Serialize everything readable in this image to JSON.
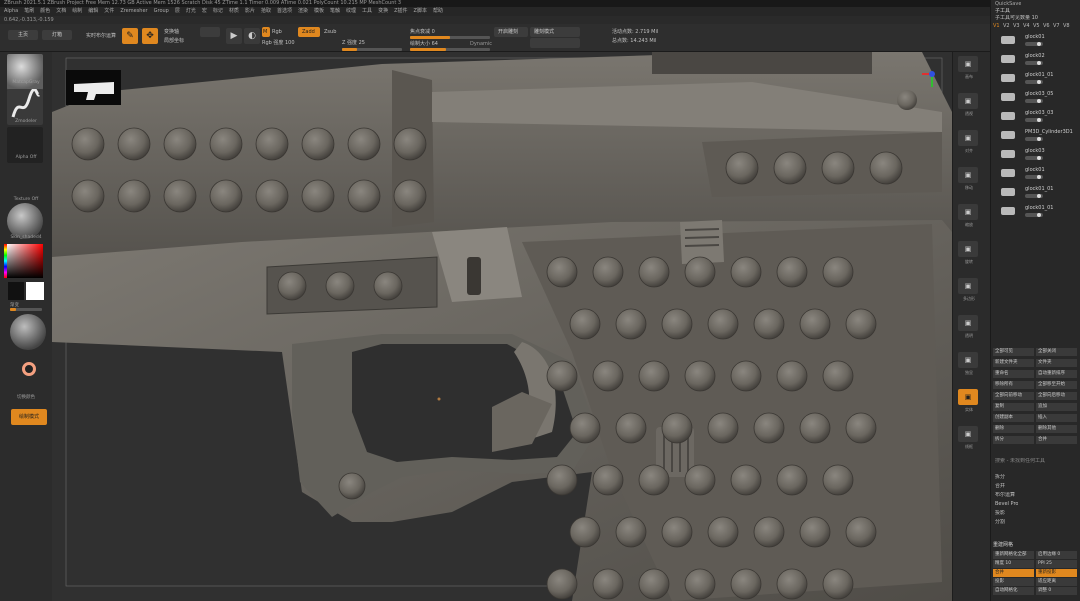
{
  "title_bar": "ZBrush 2021.5.1   ZBrush Project   Free Mem 12.73 GB   Active Mem 1526   Scratch Disk 45   ZTime 1.1   Timer 0.009   ATime 0.021   PolyCount 10.215 MP   MeshCount 3",
  "title_right": {
    "quicksave": "QuickSave",
    "seethrough": "透明度 0",
    "menus": "菜单",
    "script": "DefaultZScript"
  },
  "menu_items": [
    "Alpha",
    "笔刷",
    "颜色",
    "文档",
    "绘制",
    "编辑",
    "文件",
    "Zremesher",
    "Group",
    "层",
    "灯光",
    "宏",
    "标记",
    "材质",
    "影片",
    "拾取",
    "首选项",
    "渲染",
    "模板",
    "笔触",
    "纹理",
    "工具",
    "变换",
    "Z插件",
    "Z脚本",
    "帮助"
  ],
  "coords": "0.642,-0.313,-0.159",
  "toolbar": {
    "home": "主页",
    "lightbox": "灯箱",
    "live_boolean": "实时布尔运算",
    "edit_icon": "✎",
    "draw_icon": "✥",
    "transform_axis": "变换轴",
    "local_coords": "局部坐标",
    "mrgb": "Mrgb",
    "rgb": "Rgb",
    "rgb_intensity": "Rgb 强度 100",
    "m": "M",
    "zadd": "Zadd",
    "zsub": "Zsub",
    "z_intensity": "Z 强度 25",
    "focal_shift": "焦点衰减 0",
    "draw_size": "绘制大小 64",
    "dynamic": "Dynamic",
    "active_points": "活动点数: 2.719 Mil",
    "total_points": "总点数: 14.243 Mil",
    "sculpt_toggle": "开启雕刻",
    "sculpt_mode": "雕刻模式"
  },
  "left_panel": {
    "brush1": "MatcapGray",
    "brush2": "Zmodeler",
    "alpha": "Alpha Off",
    "texture": "Texture Off",
    "material": "Skin_shaded4",
    "gradient_label": "渐变",
    "switch_color": "切换颜色",
    "edit_mode": "绘制模式"
  },
  "right_strip": [
    "画布",
    "透视",
    "对齐",
    "移动",
    "缩放",
    "旋转",
    "多边形",
    "透明",
    "独显",
    "实体",
    "线框"
  ],
  "right_panel": {
    "header": "子工具",
    "list_count": "子工具可见数量  10",
    "vtabs": [
      "V1",
      "V2",
      "V3",
      "V4",
      "V5",
      "V6",
      "V7",
      "V8"
    ],
    "items": [
      "glock01",
      "glock02",
      "glock01_01",
      "glock03_05",
      "glock03_03",
      "PM3D_Cylinder3D1",
      "glock03",
      "glock01",
      "glock01_01",
      "glock01_01"
    ],
    "actions": [
      [
        "全部可见",
        "全部关闭"
      ],
      [
        "新建文件夹",
        "文件夹"
      ],
      [
        "重命名",
        "自动重新排序"
      ],
      [
        "移除所有",
        "全部移至开始"
      ],
      [
        "全部向前移动",
        "全部向后移动"
      ],
      [
        "复制",
        "追加"
      ],
      [
        "创建副本",
        "插入"
      ],
      [
        "删除",
        "删除其他"
      ],
      [
        "拆分",
        "合并"
      ]
    ],
    "search_hint": "搜索 - 未找到任何工具",
    "ops": [
      "拆分",
      "合并",
      "布尔运算",
      "Bevel Pro",
      "投影",
      "分割"
    ],
    "remesh": "重建网格",
    "bottom": [
      [
        "重新网格化全部",
        "启用边缘 0"
      ],
      [
        "精度 10",
        "PPI 25"
      ],
      [
        "合并",
        "重新投影"
      ],
      [
        "投影",
        "适应距离"
      ],
      [
        "自动网格化",
        "调整 0"
      ]
    ]
  },
  "colors": {
    "accent": "#e0881f",
    "model": "#6f6b65",
    "bg": "#2f2f2f"
  }
}
